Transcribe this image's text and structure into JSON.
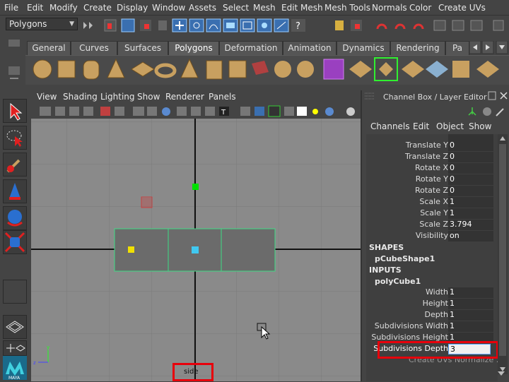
{
  "menubar": {
    "items": [
      "File",
      "Edit",
      "Modify",
      "Create",
      "Display",
      "Window",
      "Assets",
      "Select",
      "Mesh",
      "Edit Mesh",
      "Mesh Tools",
      "Normals",
      "Color",
      "Create UVs"
    ]
  },
  "statusline": {
    "mode": "Polygons"
  },
  "shelf": {
    "tabs": [
      "General",
      "Curves",
      "Surfaces",
      "Polygons",
      "Deformation",
      "Animation",
      "Dynamics",
      "Rendering",
      "Pa"
    ],
    "active_tab": "Polygons"
  },
  "viewport": {
    "menu": [
      "View",
      "Shading",
      "Lighting",
      "Show",
      "Renderer",
      "Panels"
    ],
    "camera_label": "side"
  },
  "channelbox": {
    "title": "Channel Box / Layer Editor",
    "menu": [
      "Channels",
      "Edit",
      "Object",
      "Show"
    ],
    "transform_rows": [
      {
        "label": "Translate Y",
        "value": "0"
      },
      {
        "label": "Translate Z",
        "value": "0"
      },
      {
        "label": "Rotate X",
        "value": "0"
      },
      {
        "label": "Rotate Y",
        "value": "0"
      },
      {
        "label": "Rotate Z",
        "value": "0"
      },
      {
        "label": "Scale X",
        "value": "1"
      },
      {
        "label": "Scale Y",
        "value": "1"
      },
      {
        "label": "Scale Z",
        "value": "3.794"
      },
      {
        "label": "Visibility",
        "value": "on"
      }
    ],
    "shapes_header": "SHAPES",
    "shape_name": "pCubeShape1",
    "inputs_header": "INPUTS",
    "input_name": "polyCube1",
    "input_rows": [
      {
        "label": "Width",
        "value": "1"
      },
      {
        "label": "Height",
        "value": "1"
      },
      {
        "label": "Depth",
        "value": "1"
      },
      {
        "label": "Subdivisions Width",
        "value": "1"
      },
      {
        "label": "Subdivisions Height",
        "value": "1"
      },
      {
        "label": "Subdivisions Depth",
        "value": "3"
      }
    ],
    "footer": "Create UVs Normalize ..."
  },
  "colors": {
    "highlight_box": "#e8000b",
    "mesh_edge": "#3ddc84",
    "manip_green": "#00e000",
    "manip_yellow": "#f0e000",
    "manip_cyan": "#40c8f0",
    "manip_red": "#c84040"
  },
  "icons": [
    "select-tool-icon",
    "lasso-tool-icon",
    "paint-select-icon",
    "move-tool-icon",
    "rotate-tool-icon",
    "scale-tool-icon",
    "layout-icon",
    "maya-logo-icon"
  ]
}
